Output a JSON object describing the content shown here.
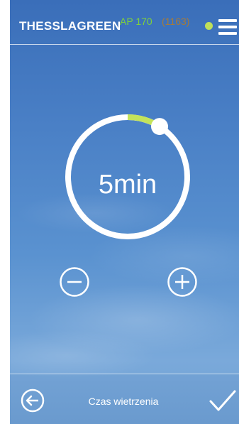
{
  "header": {
    "brand": "THESSLAGREEN",
    "model": "AP 170",
    "serial": "(1163)",
    "status_color": "#bfe05a",
    "menu_icon": "hamburger-menu-icon"
  },
  "timer": {
    "value": "5min",
    "progress_fraction": 0.09,
    "progress_color": "#c4e35a",
    "decrease_icon": "minus-circle-icon",
    "increase_icon": "plus-circle-icon"
  },
  "footer": {
    "back_icon": "back-arrow-icon",
    "title": "Czas wietrzenia",
    "confirm_icon": "checkmark-icon"
  },
  "colors": {
    "model_text": "#7fd13b",
    "serial_text": "#a57b3a",
    "sky_top": "#3a6eb9",
    "sky_bottom": "#7aa9da"
  }
}
